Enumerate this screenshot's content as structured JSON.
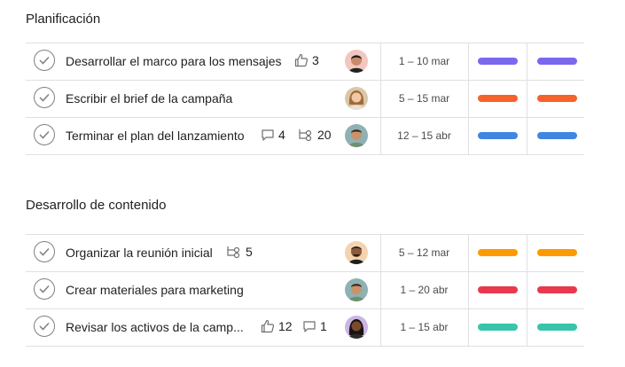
{
  "sections": [
    {
      "title": "Planificación",
      "tasks": [
        {
          "name": "Desarrollar el marco para los mensajes",
          "likes": "3",
          "comments": null,
          "subtasks": null,
          "date": "1 – 10 mar",
          "color": "#7b68ee",
          "avatar": "avatar-1"
        },
        {
          "name": "Escribir el brief de la campaña",
          "likes": null,
          "comments": null,
          "subtasks": null,
          "date": "5 – 15 mar",
          "color": "#f5622a",
          "avatar": "avatar-2"
        },
        {
          "name": "Terminar el plan del lanzamiento",
          "likes": null,
          "comments": "4",
          "subtasks": "20",
          "date": "12 – 15 abr",
          "color": "#4186e0",
          "avatar": "avatar-3"
        }
      ]
    },
    {
      "title": "Desarrollo de contenido",
      "tasks": [
        {
          "name": "Organizar la reunión inicial",
          "likes": null,
          "comments": null,
          "subtasks": "5",
          "date": "5 – 12 mar",
          "color": "#fd9a00",
          "avatar": "avatar-4"
        },
        {
          "name": "Crear materiales para marketing",
          "likes": null,
          "comments": null,
          "subtasks": null,
          "date": "1 – 20 abr",
          "color": "#e8384f",
          "avatar": "avatar-3"
        },
        {
          "name": "Revisar los activos de la camp...",
          "likes": "12",
          "comments": "1",
          "subtasks": null,
          "date": "1 – 15 abr",
          "color": "#37c5ab",
          "avatar": "avatar-5"
        }
      ]
    }
  ]
}
